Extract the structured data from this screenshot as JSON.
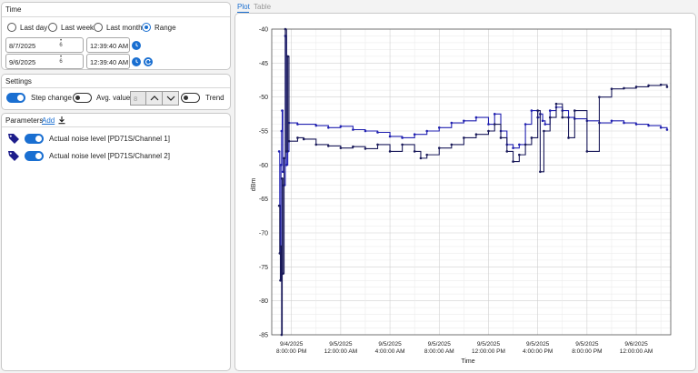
{
  "time": {
    "title": "Time",
    "options": [
      "Last day",
      "Last week",
      "Last month",
      "Range"
    ],
    "selected": "Range",
    "start_date": "8/7/2025",
    "start_time": "12:39:40 AM",
    "end_date": "9/6/2025",
    "end_time": "12:39:40 AM",
    "spin_day": "6"
  },
  "settings": {
    "title": "Settings",
    "step_change_label": "Step change",
    "step_change_on": true,
    "avg_value_label": "Avg. value",
    "avg_value_on": false,
    "avg_value": "8",
    "trend_label": "Trend",
    "trend_on": false
  },
  "parameters": {
    "title": "Parameters",
    "add_label": "Add",
    "items": [
      {
        "label": "Actual noise level [PD71S/Channel 1]",
        "enabled": true
      },
      {
        "label": "Actual noise level [PD71S/Channel 2]",
        "enabled": true
      }
    ]
  },
  "view_tabs": {
    "plot": "Plot",
    "table": "Table",
    "active": "Plot"
  },
  "colors": {
    "accent": "#1a6fd1",
    "series1": "#2020b0",
    "series2": "#1a1a5a",
    "tag": "#1e1e8c"
  },
  "icons": {
    "download": "download-icon",
    "calendar": "calendar-icon",
    "refresh": "refresh-icon",
    "tag": "tag-icon"
  },
  "chart_data": {
    "type": "line",
    "xlabel": "Time",
    "ylabel": "dBm",
    "ylim": [
      -85,
      -40
    ],
    "yticks": [
      -40,
      -45,
      -50,
      -55,
      -60,
      -65,
      -70,
      -75,
      -80,
      -85
    ],
    "xticks": [
      {
        "date": "9/4/2025",
        "time": "8:00:00 PM"
      },
      {
        "date": "9/5/2025",
        "time": "12:00:00 AM"
      },
      {
        "date": "9/5/2025",
        "time": "4:00:00 AM"
      },
      {
        "date": "9/5/2025",
        "time": "8:00:00 AM"
      },
      {
        "date": "9/5/2025",
        "time": "12:00:00 PM"
      },
      {
        "date": "9/5/2025",
        "time": "4:00:00 PM"
      },
      {
        "date": "9/5/2025",
        "time": "8:00:00 PM"
      },
      {
        "date": "9/6/2025",
        "time": "12:00:00 AM"
      }
    ],
    "x_range_hours": [
      -5.6,
      26.8
    ],
    "grid": true,
    "series": [
      {
        "name": "Actual noise level [PD71S/Channel 1]",
        "x": [
          -5.0,
          -4.95,
          -4.9,
          -4.85,
          -4.8,
          -4.75,
          -4.7,
          -4.6,
          -4.5,
          -4.4,
          -4.3,
          -4.2,
          -3.5,
          -2,
          -1,
          0,
          1,
          2,
          3,
          4,
          5,
          6,
          7,
          8,
          9,
          10,
          11,
          12,
          12.5,
          13,
          13.5,
          14,
          14.5,
          15,
          15.5,
          16,
          16.2,
          16.4,
          16.6,
          17,
          17.5,
          18,
          18.5,
          19,
          20,
          21,
          22,
          23,
          24,
          25,
          26,
          26.5
        ],
        "y": [
          -58,
          -66,
          -73,
          -60,
          -55,
          -52,
          -61,
          -63,
          -41,
          -60,
          -58,
          -53.8,
          -54,
          -54.2,
          -54.5,
          -54.3,
          -54.8,
          -55,
          -55.2,
          -55.8,
          -56,
          -55.5,
          -55,
          -54.5,
          -53.8,
          -53.5,
          -53,
          -54,
          -52.5,
          -55,
          -57,
          -57.5,
          -57,
          -54,
          -52,
          -53,
          -52.5,
          -53.5,
          -54,
          -52,
          -51.5,
          -52,
          -53,
          -53.2,
          -53.5,
          -53.8,
          -53.5,
          -53.8,
          -54,
          -54.2,
          -54.5,
          -54.8
        ]
      },
      {
        "name": "Actual noise level [PD71S/Channel 2]",
        "x": [
          -5.0,
          -4.95,
          -4.9,
          -4.85,
          -4.8,
          -4.75,
          -4.7,
          -4.6,
          -4.5,
          -4.4,
          -4.3,
          -4.2,
          -3.5,
          -3,
          -2,
          -1,
          0,
          1,
          2,
          3,
          4,
          5,
          6,
          6.5,
          7,
          8,
          9,
          10,
          11,
          12,
          12.5,
          13,
          13.5,
          14,
          14.5,
          15,
          15.5,
          16,
          16.2,
          16.5,
          17,
          17.5,
          18,
          18.5,
          19,
          20,
          21,
          22,
          23,
          24,
          25,
          26,
          26.5
        ],
        "y": [
          -66,
          -73,
          -77,
          -72,
          -85,
          -62,
          -76,
          -59,
          -40,
          -58,
          -44,
          -56.5,
          -56,
          -56.2,
          -57,
          -57.2,
          -57.5,
          -57.3,
          -57.6,
          -57,
          -58,
          -57,
          -58,
          -59,
          -58.5,
          -57.5,
          -57,
          -56,
          -55.5,
          -55,
          -54,
          -56,
          -58,
          -59.5,
          -58.5,
          -57,
          -56,
          -52,
          -61,
          -55,
          -53,
          -51,
          -53,
          -56,
          -52,
          -58,
          -50,
          -48.8,
          -48.7,
          -48.5,
          -48.3,
          -48.2,
          -48.5
        ]
      }
    ]
  }
}
